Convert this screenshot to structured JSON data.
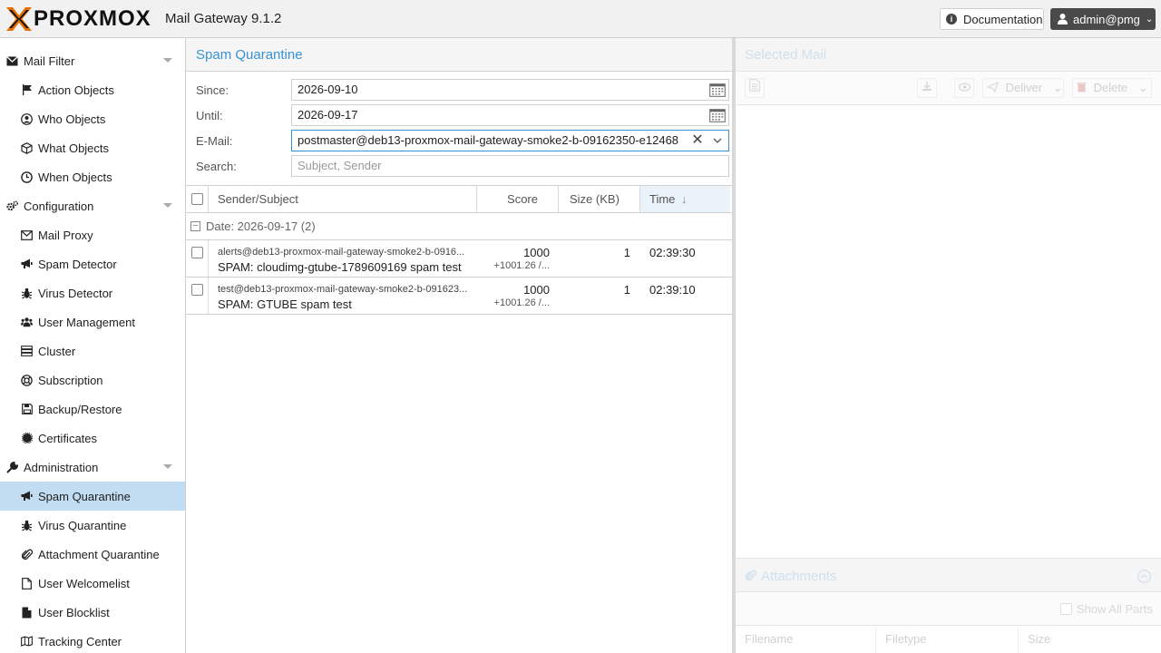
{
  "header": {
    "logo_text": "PROXMOX",
    "product": "Mail Gateway 9.1.2",
    "doc_label": "Documentation",
    "user_label": "admin@pmg"
  },
  "sidebar": {
    "items": [
      {
        "label": "Mail Filter",
        "icon": "envelope-icon",
        "cat": true
      },
      {
        "label": "Action Objects",
        "icon": "flag-icon"
      },
      {
        "label": "Who Objects",
        "icon": "user-circle-icon"
      },
      {
        "label": "What Objects",
        "icon": "cube-icon"
      },
      {
        "label": "When Objects",
        "icon": "clock-icon"
      },
      {
        "label": "Configuration",
        "icon": "gears-icon",
        "cat": true
      },
      {
        "label": "Mail Proxy",
        "icon": "envelope-outline-icon"
      },
      {
        "label": "Spam Detector",
        "icon": "bullhorn-icon"
      },
      {
        "label": "Virus Detector",
        "icon": "bug-icon"
      },
      {
        "label": "User Management",
        "icon": "users-icon"
      },
      {
        "label": "Cluster",
        "icon": "server-icon"
      },
      {
        "label": "Subscription",
        "icon": "support-icon"
      },
      {
        "label": "Backup/Restore",
        "icon": "floppy-icon"
      },
      {
        "label": "Certificates",
        "icon": "certificate-icon"
      },
      {
        "label": "Administration",
        "icon": "wrench-icon",
        "cat": true
      },
      {
        "label": "Spam Quarantine",
        "icon": "bullhorn-icon",
        "selected": true
      },
      {
        "label": "Virus Quarantine",
        "icon": "bug-icon"
      },
      {
        "label": "Attachment Quarantine",
        "icon": "paperclip-icon"
      },
      {
        "label": "User Welcomelist",
        "icon": "file-outline-icon"
      },
      {
        "label": "User Blocklist",
        "icon": "file-icon"
      },
      {
        "label": "Tracking Center",
        "icon": "map-icon"
      }
    ]
  },
  "quarantine": {
    "title": "Spam Quarantine",
    "since_label": "Since:",
    "since_value": "2026-09-10",
    "until_label": "Until:",
    "until_value": "2026-09-17",
    "email_label": "E-Mail:",
    "email_value": "postmaster@deb13-proxmox-mail-gateway-smoke2-b-09162350-e12468.",
    "search_label": "Search:",
    "search_placeholder": "Subject, Sender",
    "columns": {
      "sender_subject": "Sender/Subject",
      "score": "Score",
      "size": "Size (KB)",
      "time": "Time"
    },
    "group_label": "Date: 2026-09-17 (2)",
    "rows": [
      {
        "sender": "alerts@deb13-proxmox-mail-gateway-smoke2-b-0916...",
        "subject": "SPAM: cloudimg-gtube-1789609169 spam test",
        "score": "1000",
        "score_detail": "+1001.26 /...",
        "size": "1",
        "time": "02:39:30"
      },
      {
        "sender": "test@deb13-proxmox-mail-gateway-smoke2-b-091623...",
        "subject": "SPAM: GTUBE spam test",
        "score": "1000",
        "score_detail": "+1001.26 /...",
        "size": "1",
        "time": "02:39:10"
      }
    ]
  },
  "preview": {
    "title": "Selected Mail",
    "deliver_label": "Deliver",
    "delete_label": "Delete",
    "attachments_title": "Attachments",
    "show_all_parts": "Show All Parts",
    "att_columns": {
      "filename": "Filename",
      "filetype": "Filetype",
      "size": "Size"
    }
  },
  "colors": {
    "accent": "#3892d4",
    "selected": "#c2ddf2",
    "logo_orange": "#e57000"
  }
}
